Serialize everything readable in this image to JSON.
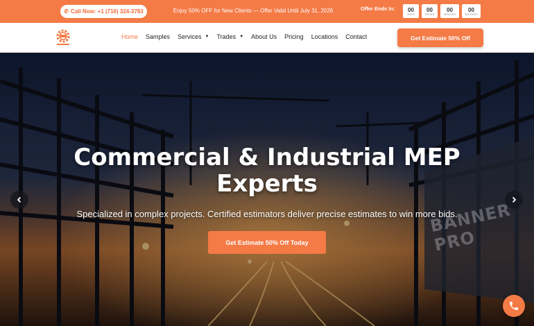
{
  "topbar": {
    "call_label": "Call Now: +1 (716) 324-3783",
    "promo_text": "Enjoy 50% OFF for New Clients — Offer Valid Until July 31, 2026",
    "offer_label": "Offer Ends In:",
    "countdown": [
      {
        "value": "00",
        "unit": "DAYS"
      },
      {
        "value": "00",
        "unit": "HOURS"
      },
      {
        "value": "00",
        "unit": "MINUTES"
      },
      {
        "value": "00",
        "unit": "SECONDS"
      }
    ]
  },
  "nav": {
    "items": [
      {
        "label": "Home",
        "active": true
      },
      {
        "label": "Samples"
      },
      {
        "label": "Services",
        "dropdown": true
      },
      {
        "label": "Trades",
        "dropdown": true
      },
      {
        "label": "About Us"
      },
      {
        "label": "Pricing"
      },
      {
        "label": "Locations"
      },
      {
        "label": "Contact"
      }
    ],
    "cta_label": "Get Estimate 50% Off"
  },
  "hero": {
    "title_line1": "Commercial & Industrial MEP",
    "title_line2": "Experts",
    "subtitle": "Specialized in complex projects. Certified estimators deliver precise estimates to win more bids.",
    "cta_label": "Get Estimate 50% Off Today",
    "background_banner_text": "BANNER PRO"
  },
  "colors": {
    "accent": "#f47a46",
    "topbar_bg": "#f47a46",
    "nav_bg": "#ffffff",
    "hero_text": "#ffffff"
  },
  "icons": {
    "call": "phone-icon",
    "prev": "chevron-left-icon",
    "next": "chevron-right-icon",
    "fab": "phone-icon",
    "logo": "gear-logo-icon"
  }
}
